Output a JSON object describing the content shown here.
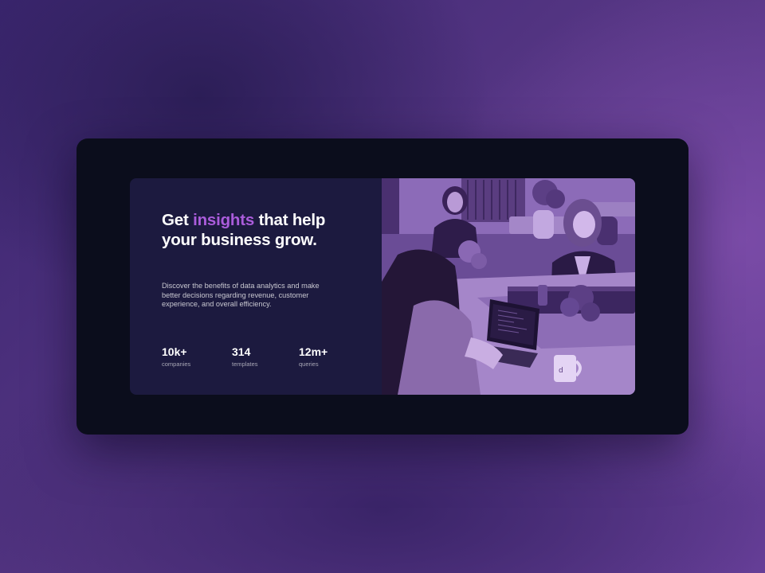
{
  "hero": {
    "headline": {
      "before": "Get ",
      "accent": "insights",
      "after": " that help your business grow."
    },
    "description": "Discover the benefits of data analytics and make better decisions regarding revenue, customer experience, and overall efficiency.",
    "stats": [
      {
        "value": "10k+",
        "label": "companies"
      },
      {
        "value": "314",
        "label": "templates"
      },
      {
        "value": "12m+",
        "label": "queries"
      }
    ]
  },
  "theme": {
    "page_background": "#4a2f7a",
    "frame_background": "#0b0d1c",
    "card_background": "#1c1a3f",
    "accent": "#aa5cdb",
    "image_tint": "#aa5cdb"
  },
  "image": {
    "subject": "office-meeting-photo"
  }
}
